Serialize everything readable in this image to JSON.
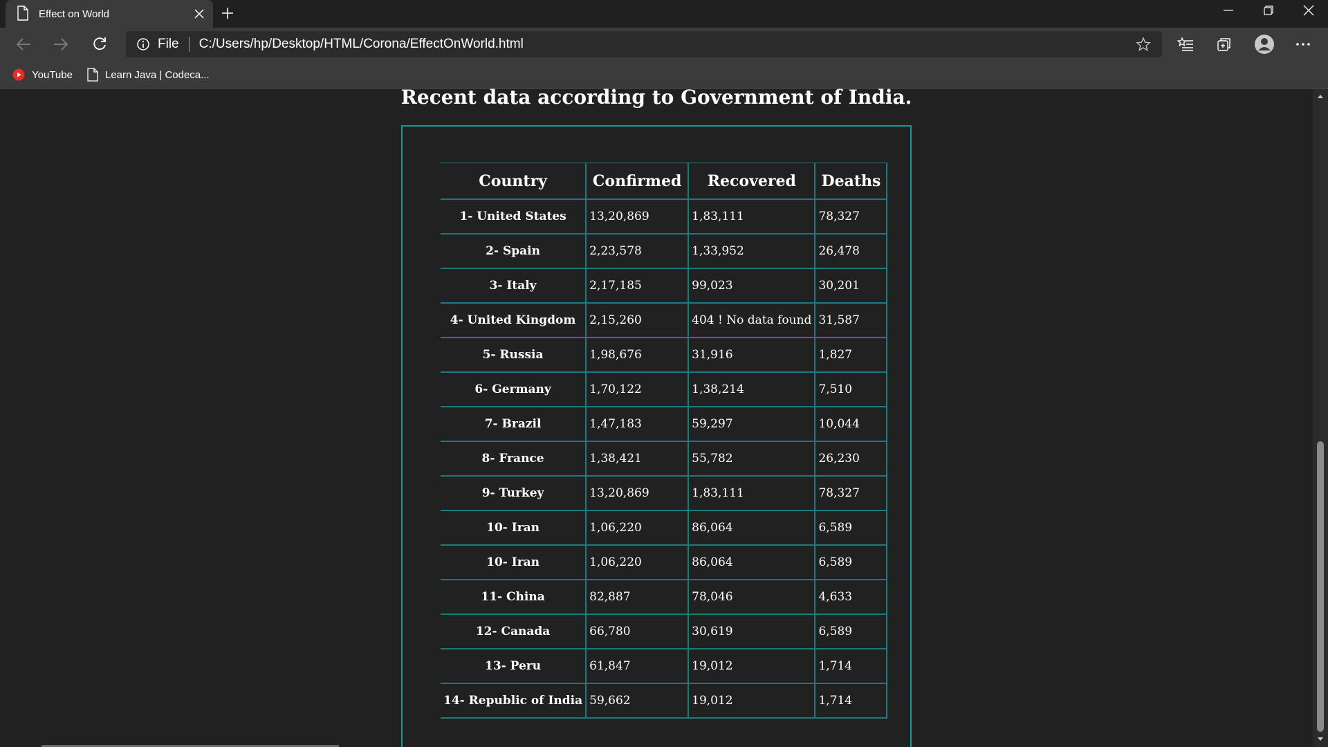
{
  "browser": {
    "tab_title": "Effect on World",
    "address_scheme": "File",
    "address_url": "C:/Users/hp/Desktop/HTML/Corona/EffectOnWorld.html",
    "favorites": [
      {
        "label": "YouTube",
        "icon": "youtube-icon"
      },
      {
        "label": "Learn Java | Codeca...",
        "icon": "page-icon"
      }
    ]
  },
  "page": {
    "heading": "Recent data according to Government of India.",
    "table": {
      "headers": [
        "Country",
        "Confirmed",
        "Recovered",
        "Deaths"
      ],
      "rows": [
        [
          "1- United States",
          "13,20,869",
          "1,83,111",
          "78,327"
        ],
        [
          "2- Spain",
          "2,23,578",
          "1,33,952",
          "26,478"
        ],
        [
          "3- Italy",
          "2,17,185",
          "99,023",
          "30,201"
        ],
        [
          "4- United Kingdom",
          "2,15,260",
          "404 ! No data found",
          "31,587"
        ],
        [
          "5- Russia",
          "1,98,676",
          "31,916",
          "1,827"
        ],
        [
          "6- Germany",
          "1,70,122",
          "1,38,214",
          "7,510"
        ],
        [
          "7- Brazil",
          "1,47,183",
          "59,297",
          "10,044"
        ],
        [
          "8- France",
          "1,38,421",
          "55,782",
          "26,230"
        ],
        [
          "9- Turkey",
          "13,20,869",
          "1,83,111",
          "78,327"
        ],
        [
          "10- Iran",
          "1,06,220",
          "86,064",
          "6,589"
        ],
        [
          "10- Iran",
          "1,06,220",
          "86,064",
          "6,589"
        ],
        [
          "11- China",
          "82,887",
          "78,046",
          "4,633"
        ],
        [
          "12- Canada",
          "66,780",
          "30,619",
          "6,589"
        ],
        [
          "13- Peru",
          "61,847",
          "19,012",
          "1,714"
        ],
        [
          "14- Republic of India",
          "59,662",
          "19,012",
          "1,714"
        ]
      ]
    }
  },
  "colors": {
    "background": "#212121",
    "accent": "#159a9c",
    "chrome": "#3b3b3b"
  }
}
